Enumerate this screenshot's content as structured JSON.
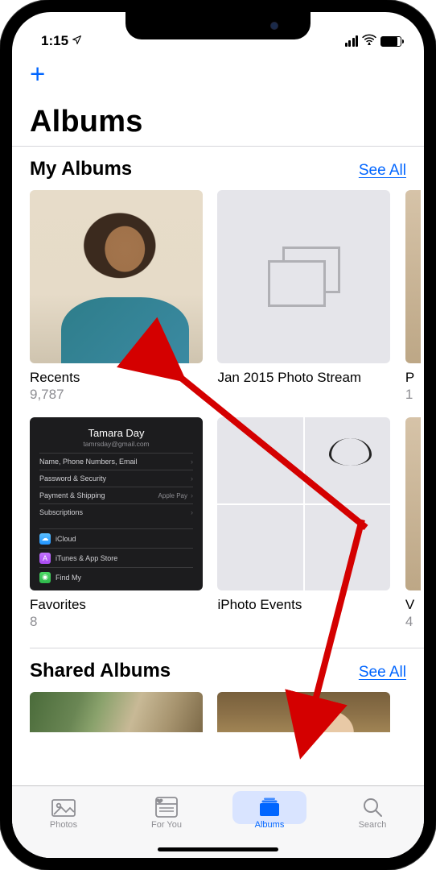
{
  "status": {
    "time": "1:15",
    "location_arrow": "➤"
  },
  "nav": {
    "add_label": "+"
  },
  "page": {
    "title": "Albums"
  },
  "sections": {
    "my_albums": {
      "heading": "My Albums",
      "see_all": "See All"
    },
    "shared_albums": {
      "heading": "Shared Albums",
      "see_all": "See All"
    }
  },
  "albums_row1": [
    {
      "name": "Recents",
      "count": "9,787"
    },
    {
      "name": "Jan 2015 Photo Stream",
      "count": ""
    },
    {
      "name": "P",
      "count": "1"
    }
  ],
  "albums_row2": [
    {
      "name": "Favorites",
      "count": "8"
    },
    {
      "name": "iPhoto Events",
      "count": ""
    },
    {
      "name": "V",
      "count": "4"
    }
  ],
  "settings_card": {
    "profile_name": "Tamara Day",
    "profile_email": "tamrsday@gmail.com",
    "rows": [
      {
        "label": "Name, Phone Numbers, Email",
        "right": ""
      },
      {
        "label": "Password & Security",
        "right": ""
      },
      {
        "label": "Payment & Shipping",
        "right": "Apple Pay"
      },
      {
        "label": "Subscriptions",
        "right": ""
      }
    ],
    "app_rows": [
      {
        "label": "iCloud"
      },
      {
        "label": "iTunes & App Store"
      },
      {
        "label": "Find My"
      }
    ]
  },
  "tabs": {
    "photos": "Photos",
    "for_you": "For You",
    "albums": "Albums",
    "search": "Search"
  }
}
